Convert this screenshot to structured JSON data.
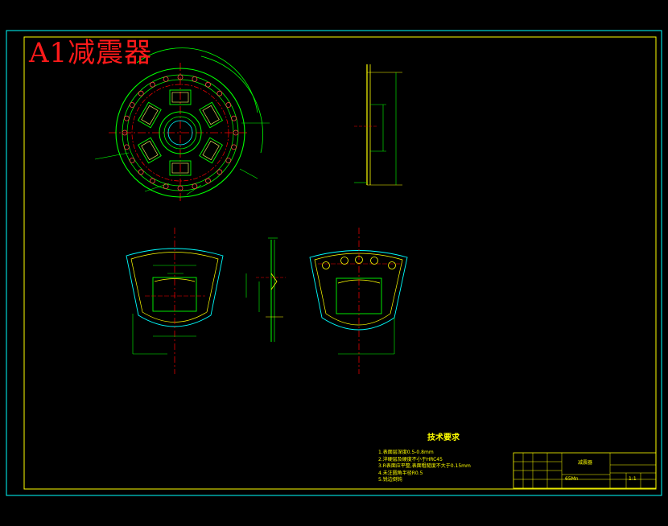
{
  "drawing": {
    "title": "A1减震器"
  },
  "tech_requirements": {
    "title": "技术要求",
    "items": [
      "1.表面层深度0.5-0.8mm",
      "2.淬硬层及硬度不小于HRC45",
      "3.R表面应平整,表面粗糙度不大于0.15mm",
      "4.未注圆角半径R0.5",
      "5.锐边倒钝"
    ]
  },
  "title_block": {
    "part_name": "减震器",
    "material": "65Mn",
    "scale": "1:1"
  },
  "colors": {
    "background": "#000000",
    "frame": "#00ffff",
    "inner_frame": "#ffff00",
    "part_outline": "#00ff00",
    "centerline": "#ff0000",
    "dimension": "#00ff00",
    "title": "#ff1a1a",
    "text": "#ffff00",
    "holes": "#ff4444",
    "arc": "#ffff66"
  }
}
